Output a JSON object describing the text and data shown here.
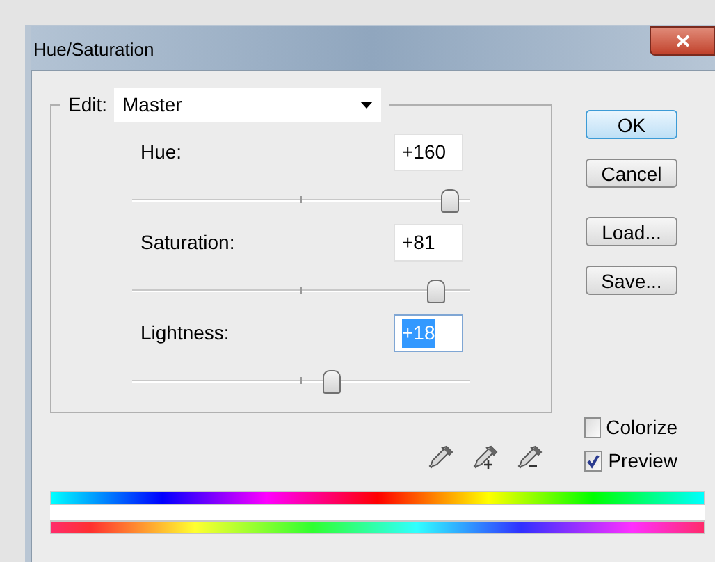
{
  "window": {
    "title": "Hue/Saturation"
  },
  "edit": {
    "label": "Edit:",
    "value": "Master"
  },
  "adjustments": [
    {
      "label": "Hue:",
      "value": "+160",
      "level": 0.94,
      "selected": false
    },
    {
      "label": "Saturation:",
      "value": "+81",
      "level": 0.9,
      "selected": false
    },
    {
      "label": "Lightness:",
      "value": "+18",
      "level": 0.59,
      "selected": true
    }
  ],
  "buttons": [
    {
      "label": "OK",
      "default": true
    },
    {
      "label": "Cancel",
      "default": false
    },
    {
      "label": "Load...",
      "default": false
    },
    {
      "label": "Save...",
      "default": false
    }
  ],
  "eyedroppers": [
    {
      "kind": "plain"
    },
    {
      "kind": "add"
    },
    {
      "kind": "subtract"
    }
  ],
  "options": [
    {
      "label": "Colorize",
      "checked": false
    },
    {
      "label": "Preview",
      "checked": true
    }
  ]
}
